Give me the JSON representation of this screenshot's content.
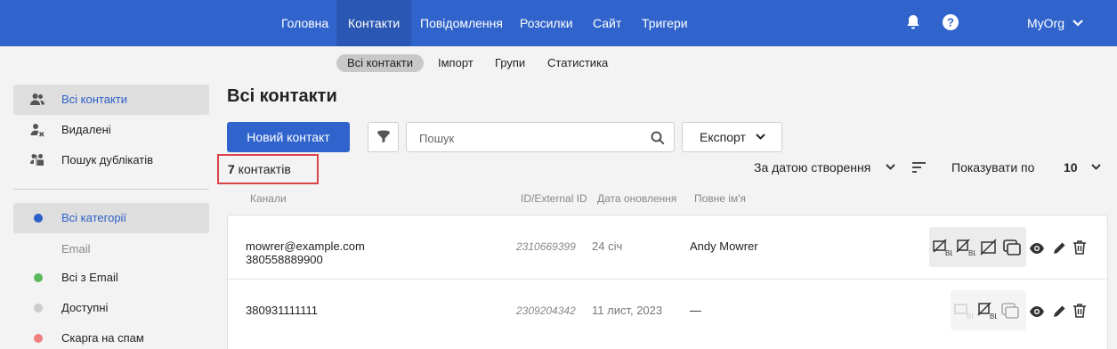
{
  "nav": {
    "items": [
      "Головна",
      "Контакти",
      "Повідомлення",
      "Розсилки",
      "Сайт",
      "Тригери"
    ],
    "active": "Контакти",
    "org": "MyOrg",
    "bell_icon": "bell-icon",
    "help_icon": "help-icon"
  },
  "subnav": {
    "items": [
      "Всі контакти",
      "Імпорт",
      "Групи",
      "Статистика"
    ],
    "active": "Всі контакти"
  },
  "sidebar": {
    "items": [
      {
        "label": "Всі контакти",
        "icon": "users-icon",
        "active": true
      },
      {
        "label": "Видалені",
        "icon": "user-remove-icon"
      },
      {
        "label": "Пошук дублікатів",
        "icon": "duplicates-icon"
      }
    ],
    "categories": [
      {
        "label": "Всі категорії",
        "color": "#2d5fc7",
        "active": true
      },
      {
        "group": "Email"
      },
      {
        "label": "Всі з Email",
        "color": "#5cb85c"
      },
      {
        "label": "Доступні",
        "color": "#cccccc"
      },
      {
        "label": "Скарга на спам",
        "color": "#f08080"
      }
    ]
  },
  "main": {
    "title": "Всі контакти",
    "new_button": "Новий контакт",
    "search_placeholder": "Пошук",
    "export_button": "Експорт",
    "count_number": "7",
    "count_label": " контактів",
    "sort_label": "За датою створення",
    "per_page_label": "Показувати по",
    "per_page_value": "10",
    "columns": [
      "Канали",
      "ID/External ID",
      "Дата оновлення",
      "Повне ім'я"
    ]
  },
  "rows": [
    {
      "email": "mowrer@example.com",
      "phone": "380558889900",
      "id": "2310669399",
      "date": "24 січ",
      "name": "Andy Mowrer"
    },
    {
      "email": "",
      "phone": "380931111111",
      "id": "2309204342",
      "date": "11 лист, 2023",
      "name": "—"
    }
  ],
  "colors": {
    "accent": "#3064cc",
    "highlight": "#d9434a"
  }
}
